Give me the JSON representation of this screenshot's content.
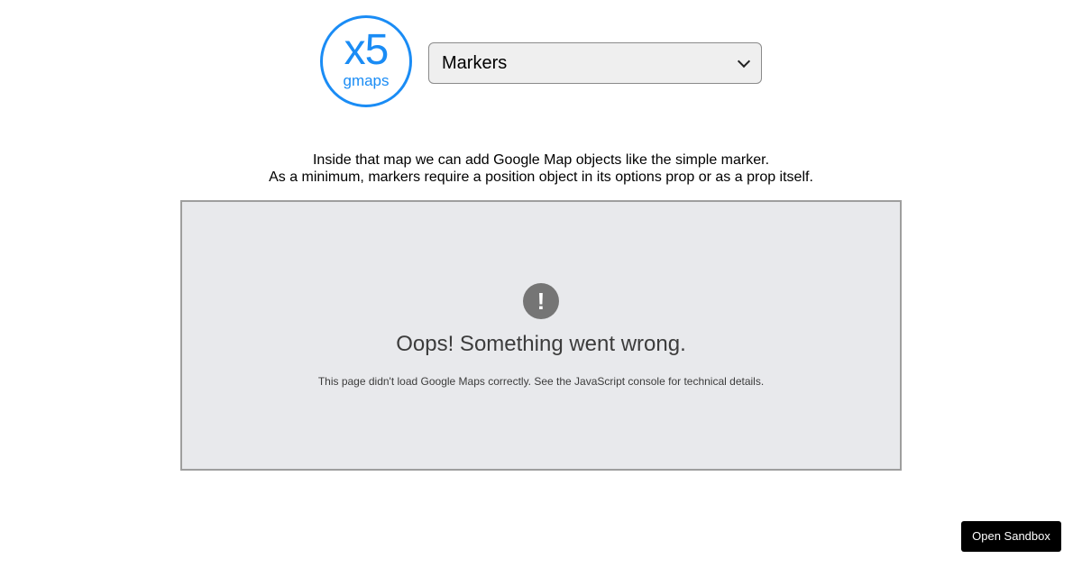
{
  "logo": {
    "main_text": "x5",
    "sub_text": "gmaps",
    "color": "#1a8cf5"
  },
  "example_select": {
    "selected": "Markers"
  },
  "description": {
    "line1": "Inside that map we can add Google Map objects like the simple marker.",
    "line2": "As a minimum, markers require a position object in its options prop or as a prop itself."
  },
  "map_error": {
    "icon": "exclamation-icon",
    "icon_glyph": "!",
    "title": "Oops! Something went wrong.",
    "detail": "This page didn't load Google Maps correctly. See the JavaScript console for technical details."
  },
  "sandbox_button": {
    "label": "Open Sandbox"
  }
}
